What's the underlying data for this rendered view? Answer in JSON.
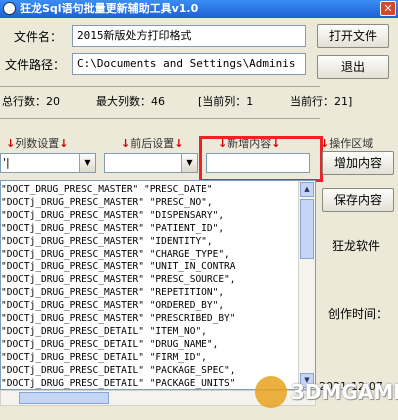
{
  "window": {
    "title": "狂龙Sql语句批量更新辅助工具v1.0",
    "close_glyph": "✕"
  },
  "form": {
    "filename_label": "文件名：",
    "filename_value": "2015新版处方打印格式",
    "filepath_label": "文件路径：",
    "filepath_value": "C:\\Documents and Settings\\Adminis",
    "open_button": "打开文件",
    "exit_button": "退出"
  },
  "stats": {
    "total_rows": "总行数：20",
    "max_cols": "最大列数：46",
    "current_col": "[当前列：1",
    "current_row": "当前行：21]"
  },
  "columns": {
    "col_settings": "列数设置",
    "before_after": "前后设置",
    "new_content": "新增内容",
    "operation_area": "操作区域",
    "arrow": "↓",
    "combo1_value": "'|",
    "combo_dd_glyph": "▼"
  },
  "buttons": {
    "add_content": "增加内容",
    "save_content": "保存内容"
  },
  "sidebar": {
    "brand": "狂龙软件",
    "created_label": "创作时间：",
    "date": "2021-12-07"
  },
  "list_rows": [
    "\"DOCT_DRUG_PRESC_MASTER\" \"PRESC_DATE\"",
    "\"DOCTj_DRUG_PRESC_MASTER\" \"PRESC_NO\",",
    "\"DOCTj_DRUG_PRESC_MASTER\" \"DISPENSARY\",",
    "\"DOCTj_DRUG_PRESC_MASTER\" \"PATIENT_ID\",",
    "\"DOCTj_DRUG_PRESC_MASTER\" \"IDENTITY\",",
    "\"DOCTj_DRUG_PRESC_MASTER\" \"CHARGE_TYPE\",",
    "\"DOCTj_DRUG_PRESC_MASTER\" \"UNIT_IN_CONTRA",
    "\"DOCTj_DRUG_PRESC_MASTER\" \"PRESC_SOURCE\",",
    "\"DOCTj_DRUG_PRESC_MASTER\" \"REPETITION\",",
    "\"DOCTj_DRUG_PRESC_MASTER\" \"ORDERED_BY\",",
    "\"DOCTj_DRUG_PRESC_MASTER\" \"PRESCRIBED_BY\"",
    "\"DOCTj_DRUG_PRESC_DETAIL\" \"ITEM_NO\",",
    "\"DOCTj_DRUG_PRESC_DETAIL\" \"DRUG_NAME\",",
    "\"DOCTj_DRUG_PRESC_DETAIL\" \"FIRM_ID\",",
    "\"DOCTj_DRUG_PRESC_DETAIL\" \"PACKAGE_SPEC\",",
    "\"DOCTj_DRUG_PRESC_DETAIL\" \"PACKAGE_UNITS\""
  ],
  "watermark": {
    "text": "3DMGAME"
  }
}
